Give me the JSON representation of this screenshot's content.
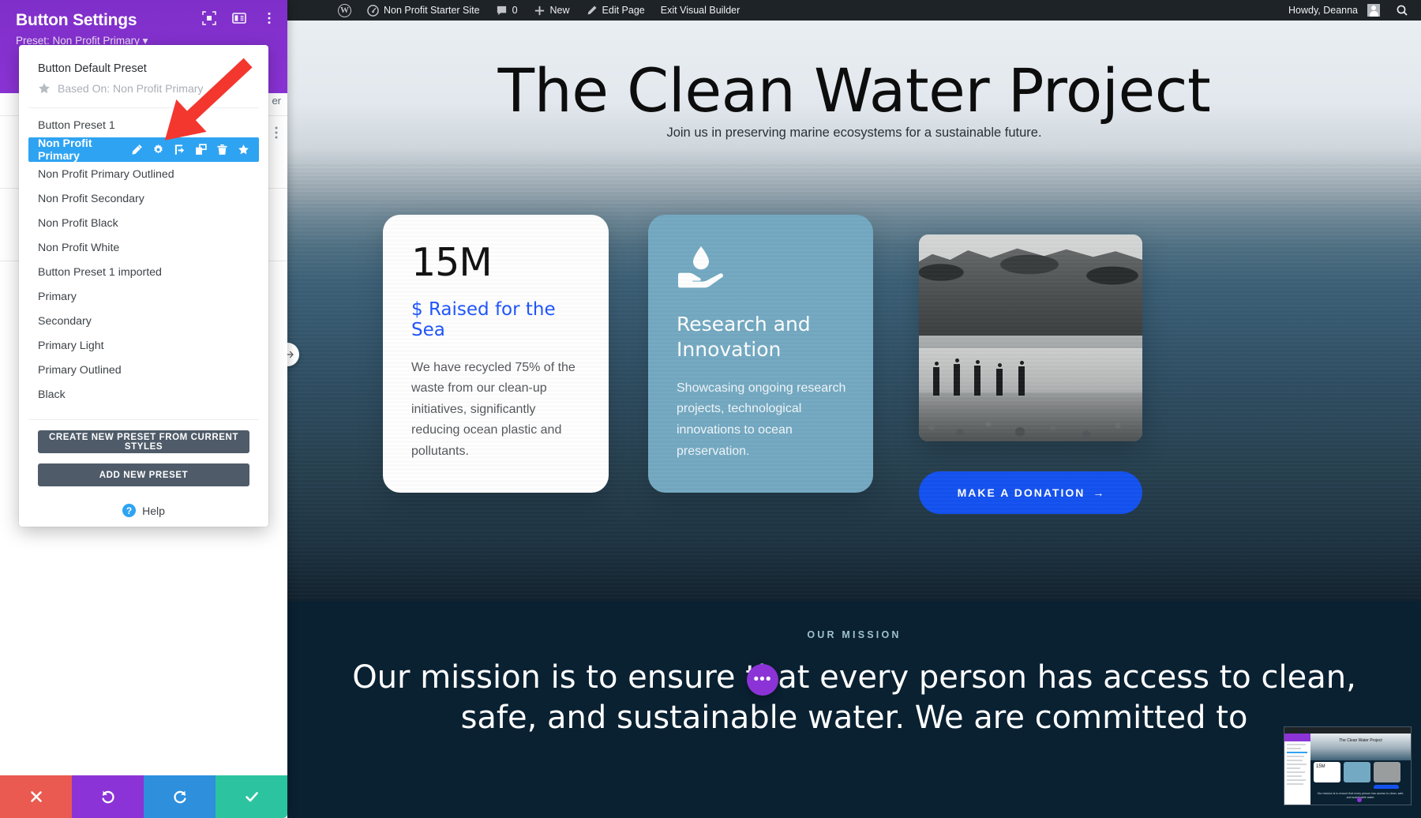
{
  "adminbar": {
    "logo_icon": "wordpress-logo-icon",
    "site_icon": "dashboard-icon",
    "site_name": "Non Profit Starter Site",
    "comments_icon": "comment-bubble-icon",
    "comments_count": "0",
    "new_icon": "plus-icon",
    "new_label": "New",
    "edit_icon": "pencil-icon",
    "edit_label": "Edit Page",
    "exit_label": "Exit Visual Builder",
    "howdy": "Howdy, Deanna",
    "avatar_icon": "user-avatar-icon",
    "search_icon": "search-icon"
  },
  "divi_panel": {
    "title": "Button Settings",
    "preset_prefix": "Preset:",
    "preset_name": "Non Profit Primary",
    "preset_caret": "▾",
    "header_icons": [
      {
        "name": "fullscreen-icon"
      },
      {
        "name": "layout-columns-icon"
      },
      {
        "name": "vertical-dots-icon"
      }
    ],
    "ghost": {
      "tab_label": "er",
      "dots_icon": "vertical-dots-icon"
    },
    "preset_dropdown": {
      "default_preset_title": "Button Default Preset",
      "star_icon": "star-icon",
      "based_on_label": "Based On: Non Profit Primary",
      "items": [
        {
          "label": "Button Preset 1",
          "active": false
        },
        {
          "label": "Non Profit Primary",
          "active": true
        },
        {
          "label": "Non Profit Primary Outlined",
          "active": false
        },
        {
          "label": "Non Profit Secondary",
          "active": false
        },
        {
          "label": "Non Profit Black",
          "active": false
        },
        {
          "label": "Non Profit White",
          "active": false
        },
        {
          "label": "Button Preset 1 imported",
          "active": false
        },
        {
          "label": "Primary",
          "active": false
        },
        {
          "label": "Secondary",
          "active": false
        },
        {
          "label": "Primary Light",
          "active": false
        },
        {
          "label": "Primary Outlined",
          "active": false
        },
        {
          "label": "Black",
          "active": false
        }
      ],
      "active_item_actions": [
        {
          "name": "rename-pencil-icon"
        },
        {
          "name": "settings-gear-icon"
        },
        {
          "name": "export-icon"
        },
        {
          "name": "duplicate-icon"
        },
        {
          "name": "trash-icon"
        },
        {
          "name": "star-icon"
        }
      ],
      "create_button_label": "CREATE NEW PRESET FROM CURRENT STYLES",
      "add_button_label": "ADD NEW PRESET",
      "help_icon": "question-mark-icon",
      "help_label": "Help"
    },
    "footer_buttons": [
      {
        "name": "close-button",
        "icon": "x-icon",
        "color": "#ea5a50"
      },
      {
        "name": "undo-button",
        "icon": "undo-arrow-icon",
        "color": "#8b33d6"
      },
      {
        "name": "redo-button",
        "icon": "redo-arrow-icon",
        "color": "#2e8fdd"
      },
      {
        "name": "save-button",
        "icon": "checkmark-icon",
        "color": "#2cc4a0"
      }
    ]
  },
  "annotation": {
    "arrow_color": "#F3372F",
    "points_to": "rename-pencil-icon"
  },
  "canvas": {
    "drag_handle_icon": "horizontal-resize-icon",
    "fab_icon": "ellipsis-icon",
    "hero": {
      "title": "The Clean Water Project",
      "subtitle": "Join us in preserving marine ecosystems for a sustainable future."
    },
    "cards": [
      {
        "type": "stat",
        "number": "15M",
        "label": "$ Raised for the Sea",
        "label_color": "#1f55ff",
        "body": "We have recycled 75% of the waste from our clean-up initiatives, significantly reducing ocean plastic and pollutants."
      },
      {
        "type": "feature",
        "icon": "hand-holding-water-drop-icon",
        "bg_color": "#73a9c2",
        "title": "Research and Innovation",
        "body": "Showcasing ongoing research projects, technological innovations to ocean preservation."
      },
      {
        "type": "image",
        "alt": "beach-photo"
      }
    ],
    "donate_button": {
      "label": "MAKE A DONATION",
      "arrow": "→",
      "color": "#1452f0"
    },
    "mission": {
      "eyebrow": "OUR MISSION",
      "text": "Our mission is to ensure that every person has access to clean, safe, and sustainable water. We are committed to"
    }
  },
  "minimap": {
    "hero_title": "The Clean Water Project",
    "stat_number": "15M",
    "mission_text": "Our mission is to ensure that every person has access to clean, safe, and sustainable water."
  }
}
